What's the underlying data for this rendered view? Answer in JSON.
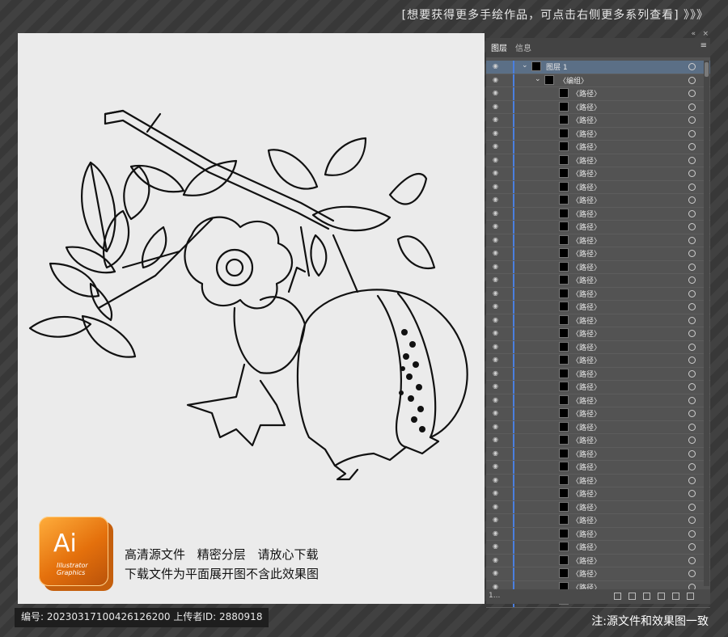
{
  "banner": {
    "text": "[想要获得更多手绘作品，可点击右侧更多系列查看]",
    "arrows": "》》》"
  },
  "badge": {
    "ai": "Ai",
    "sub1": "Illustrator",
    "sub2": "Graphics"
  },
  "captions": {
    "line1": "高清源文件 精密分层 请放心下载",
    "line2": "下载文件为平面展开图不含此效果图"
  },
  "panel": {
    "tabs": [
      "图层",
      "信息"
    ],
    "layer1": {
      "label": "图层 1"
    },
    "group": {
      "label": "〈编组〉"
    },
    "path_label": "〈路径〉",
    "path_count": 39,
    "footer_count": "1..."
  },
  "footer": {
    "id_text": "编号: 20230317100426126200 上传者ID: 2880918",
    "note": "注:源文件和效果图一致"
  },
  "colors": {
    "bg": "#3a3a3a",
    "canvas": "#ebebeb",
    "panel": "#535353",
    "accent": "#4a7fe0",
    "ai_orange": "#e4700c"
  }
}
